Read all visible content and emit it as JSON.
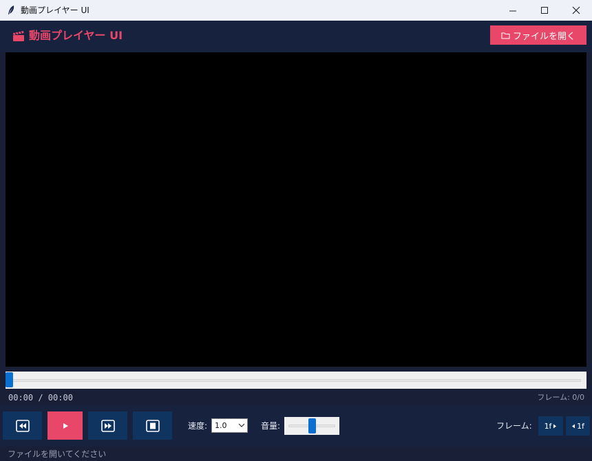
{
  "window": {
    "title": "動画プレイヤー UI"
  },
  "header": {
    "title": "動画プレイヤー UI",
    "open_button": "ファイルを開く"
  },
  "playback": {
    "time_display": "00:00 / 00:00",
    "frame_count": "フレーム: 0/0",
    "seek_fraction": 0
  },
  "controls": {
    "speed_label": "速度:",
    "speed_value": "1.0",
    "volume_label": "音量:",
    "volume_fraction": 0.5,
    "frame_label": "フレーム:",
    "frame_forward": "1f",
    "frame_back": "1f"
  },
  "status": {
    "text": "ファイルを開いてください"
  },
  "colors": {
    "accent": "#e8476a",
    "panel": "#17223f",
    "button": "#0f3460",
    "slider": "#0a6fd1"
  },
  "icons": [
    "feather-icon",
    "clapperboard-icon",
    "folder-icon",
    "rewind-icon",
    "play-icon",
    "fast-forward-icon",
    "stop-icon",
    "chevron-down-icon",
    "triangle-right-icon",
    "triangle-left-icon"
  ]
}
